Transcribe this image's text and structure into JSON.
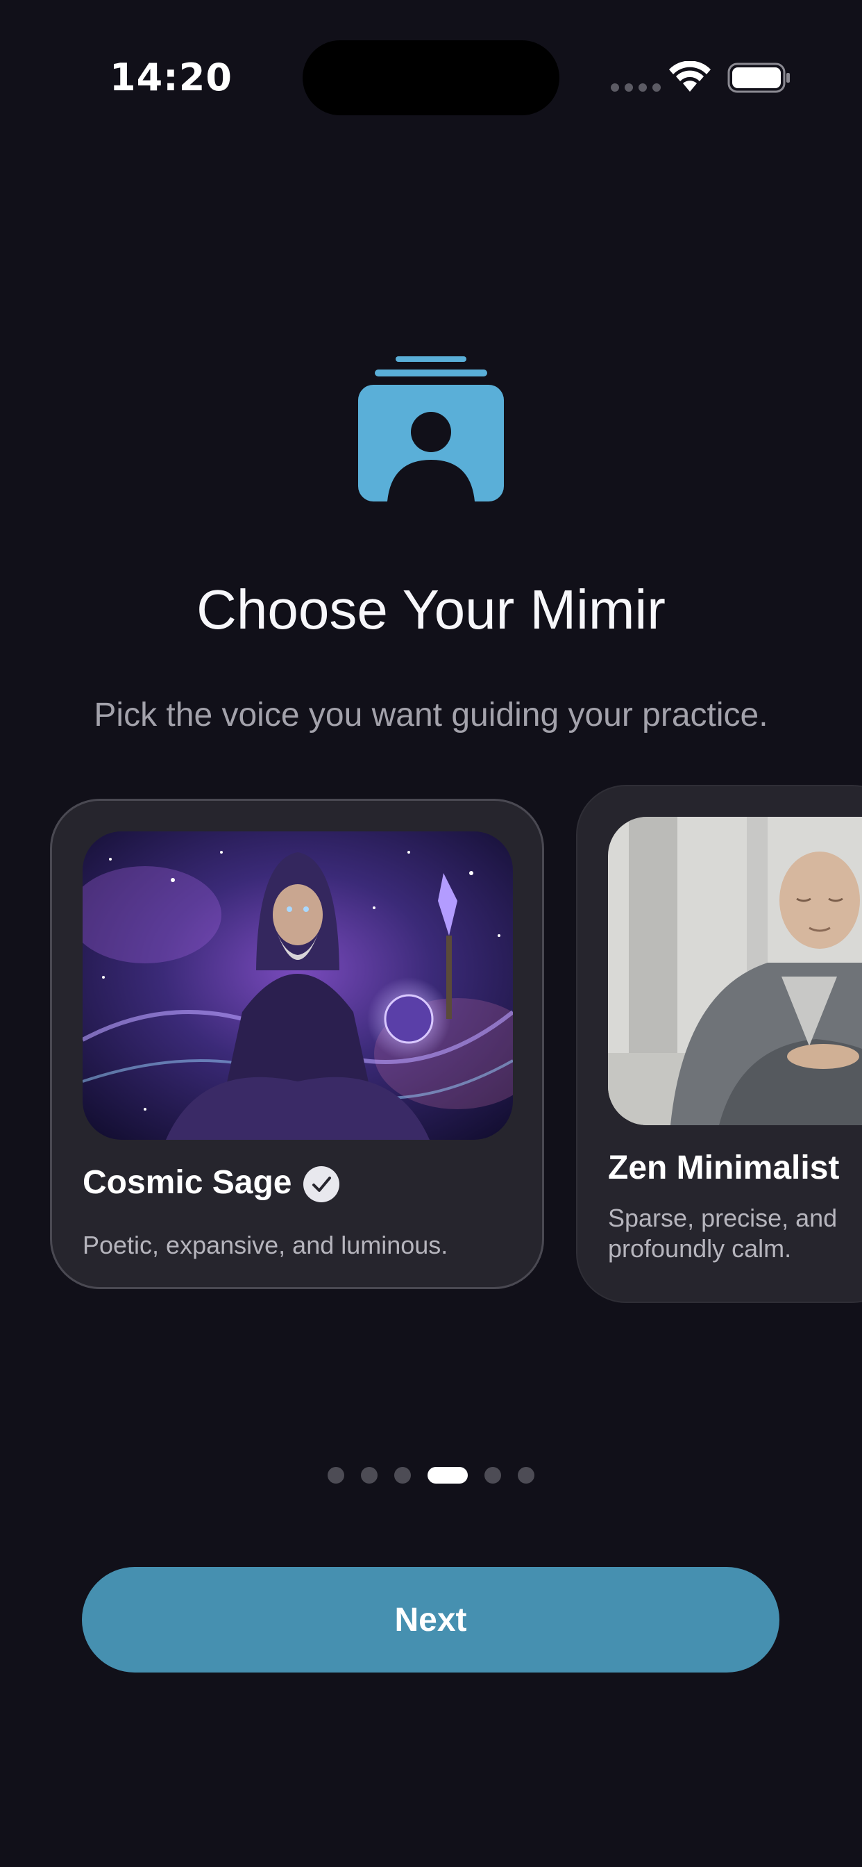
{
  "status_bar": {
    "time": "14:20"
  },
  "onboarding": {
    "title": "Choose Your Mimir",
    "subtitle": "Pick the voice you want guiding your practice.",
    "hero_icon": "person-cards-icon",
    "accent_color": "#5aafd8"
  },
  "cards": [
    {
      "name": "Cosmic Sage",
      "description": "Poetic, expansive, and luminous.",
      "selected": true
    },
    {
      "name": "Zen Minimalist",
      "description": "Sparse, precise, and profoundly calm.",
      "selected": false
    }
  ],
  "pager": {
    "total": 6,
    "current": 4
  },
  "next_button": {
    "label": "Next",
    "color": "#4690b0"
  }
}
